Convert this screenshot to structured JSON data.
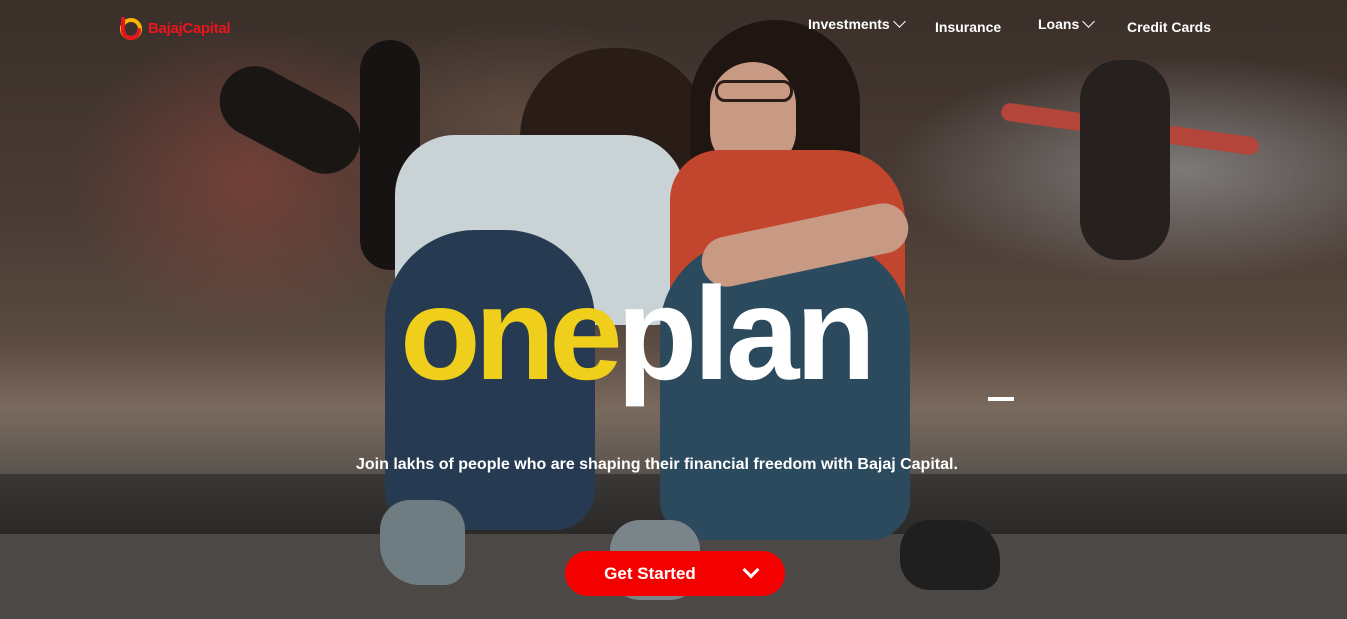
{
  "brand": {
    "name": "BajajCapital",
    "color": "#e8151e",
    "accent": "#f7b500"
  },
  "nav": {
    "items": [
      {
        "label": "Investments",
        "has_dropdown": true
      },
      {
        "label": "Insurance",
        "has_dropdown": false
      },
      {
        "label": "Loans",
        "has_dropdown": true
      },
      {
        "label": "Credit Cards",
        "has_dropdown": false
      }
    ]
  },
  "hero": {
    "headline_highlight": "one",
    "headline_main": "plan",
    "headline_highlight_color": "#f0cf1c",
    "tagline": "Join lakhs of people who are shaping their financial freedom with Bajaj Capital.",
    "cta_label": "Get Started",
    "cta_color": "#f40000",
    "cta_icon": "chevron-down-icon"
  }
}
